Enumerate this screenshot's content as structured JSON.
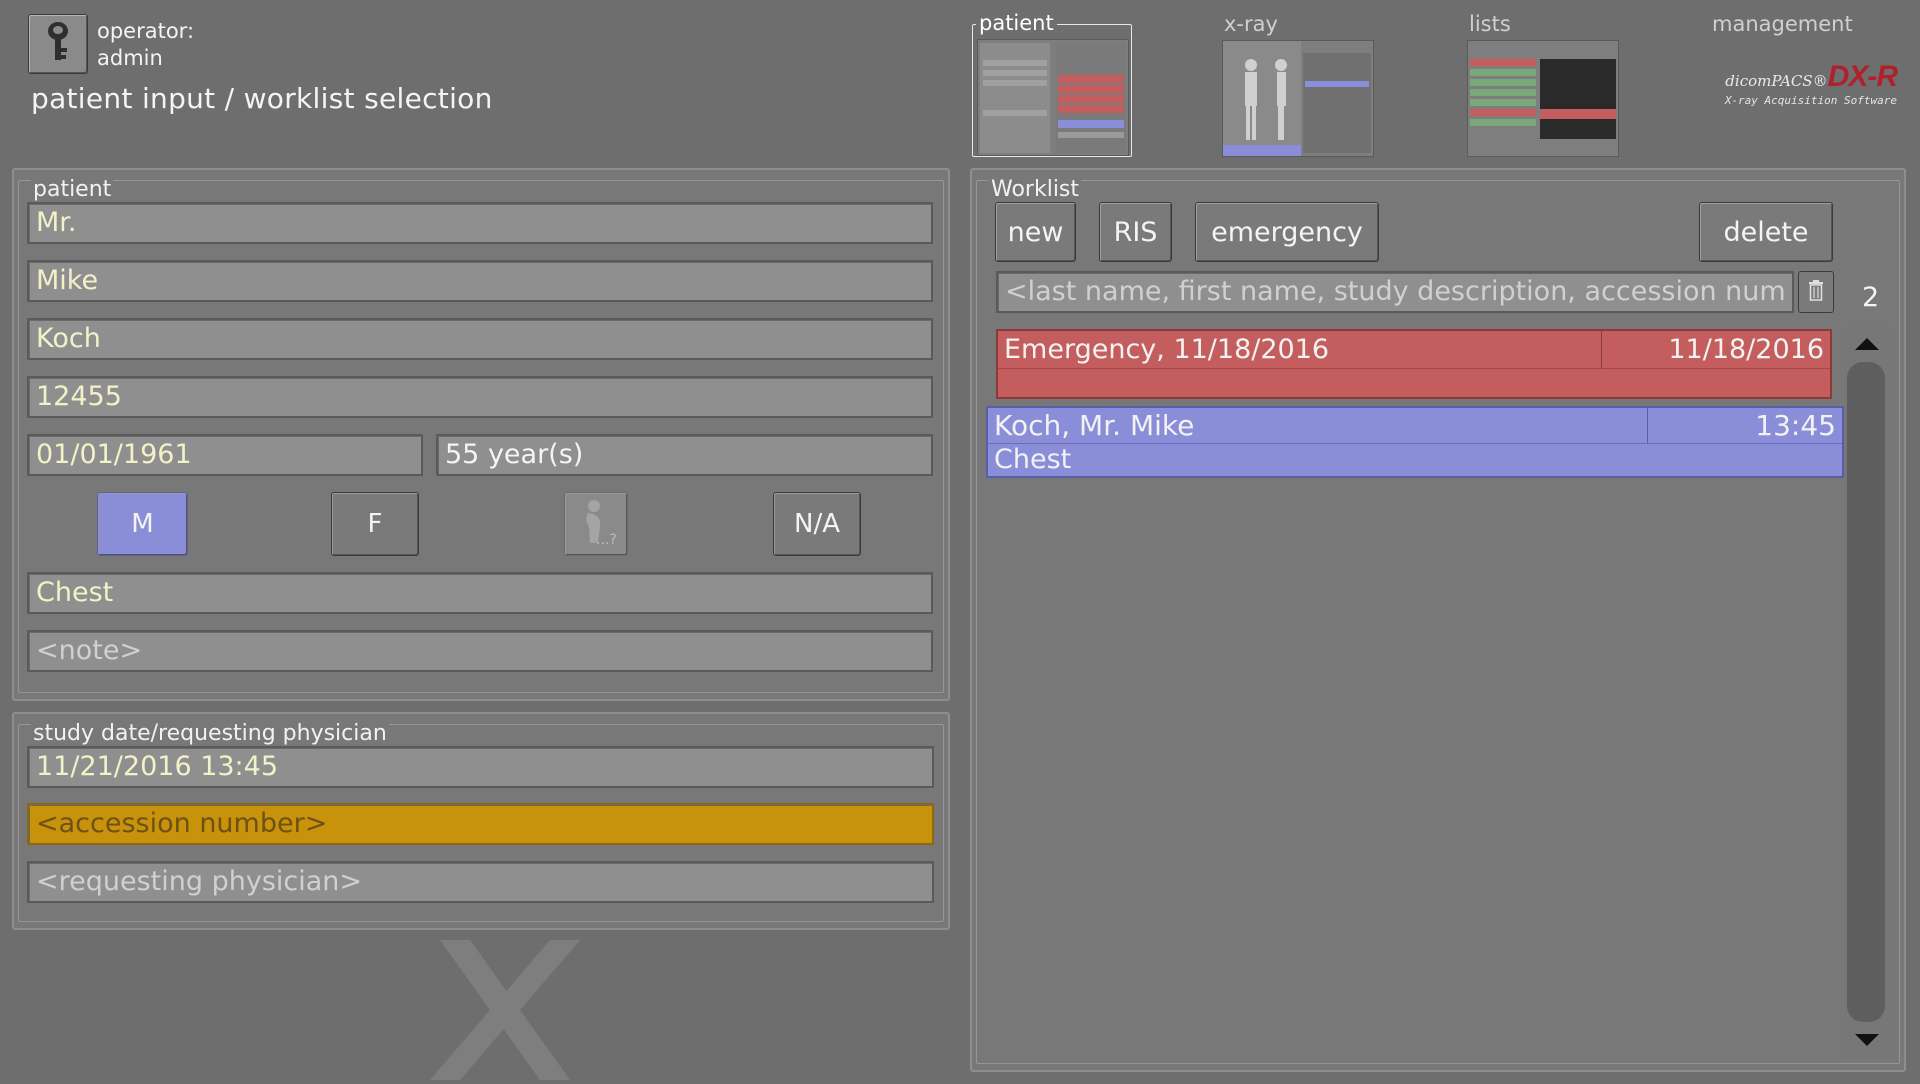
{
  "header": {
    "operator_label": "operator:",
    "operator_name": "admin",
    "page_title": "patient input / worklist selection",
    "operator_icon": "key-icon"
  },
  "nav": {
    "tabs": [
      {
        "label": "patient",
        "active": true
      },
      {
        "label": "x-ray",
        "active": false
      },
      {
        "label": "lists",
        "active": false
      },
      {
        "label": "management",
        "active": false
      }
    ]
  },
  "brand": {
    "prefix": "dicomPACS®",
    "product": "DX-R",
    "tagline": "X-ray Acquisition Software"
  },
  "patient": {
    "section_title": "patient",
    "salutation": "Mr.",
    "first_name": "Mike",
    "last_name": "Koch",
    "patient_id": "12455",
    "birth_date": "01/01/1961",
    "age": "55 year(s)",
    "sex_buttons": [
      {
        "label": "M",
        "selected": true
      },
      {
        "label": "F",
        "selected": false
      },
      {
        "label": "...?",
        "selected": false,
        "disabled": true
      },
      {
        "label": "N/A",
        "selected": false
      }
    ],
    "body_part": "Chest",
    "note_placeholder": "<note>"
  },
  "study": {
    "section_title": "study date/requesting physician",
    "date_time": "11/21/2016 13:45",
    "accession_placeholder": "<accession number>",
    "physician_placeholder": "<requesting physician>"
  },
  "worklist": {
    "section_title": "Worklist",
    "buttons": {
      "new": "new",
      "ris": "RIS",
      "emergency": "emergency",
      "delete": "delete"
    },
    "search_placeholder": "<last name, first name, study description, accession num",
    "count": "2",
    "entries": [
      {
        "name": "Emergency,  11/18/2016",
        "date": "11/18/2016",
        "description": "",
        "type": "emergency"
      },
      {
        "name": "Koch, Mr.  Mike",
        "time": "13:45",
        "description": "Chest",
        "type": "patient"
      }
    ]
  },
  "colors": {
    "background": "#6e6e6e",
    "emergency_row": "#c45e5e",
    "selected_row": "#8a8ed8",
    "accession_highlight": "#c8920a",
    "brand_red": "#b0202a"
  }
}
